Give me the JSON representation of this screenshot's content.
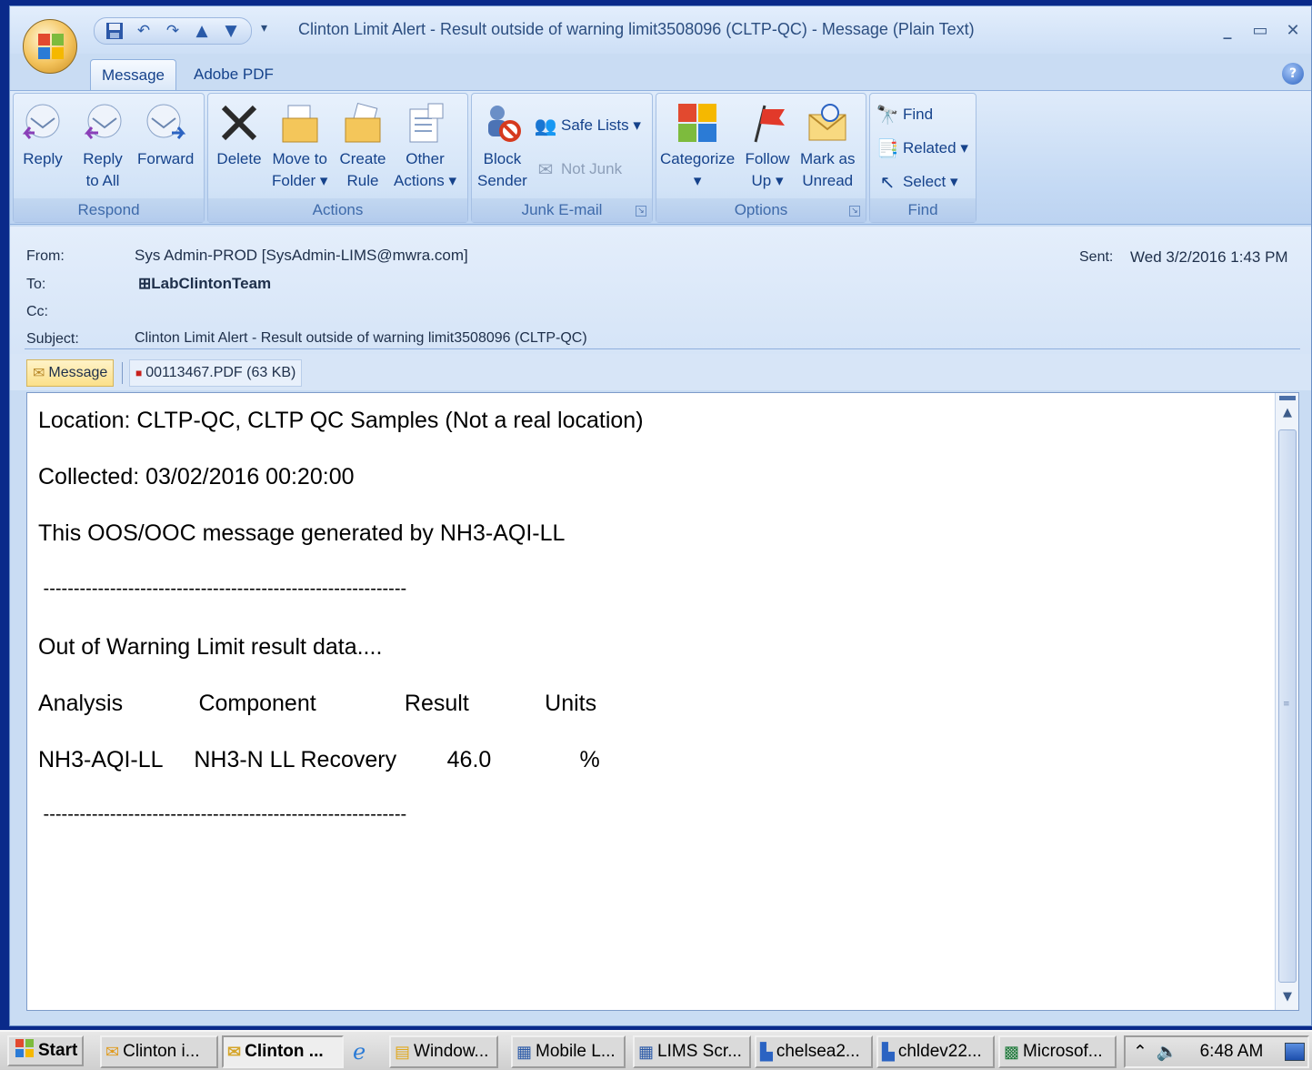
{
  "window": {
    "title": "Clinton Limit Alert - Result outside of warning limit3508096 (CLTP-QC)  - Message (Plain Text)",
    "quick_access": [
      "save-icon",
      "undo-icon",
      "redo-icon",
      "up-arrow-icon",
      "down-arrow-icon"
    ],
    "controls": [
      "minimize",
      "maximize",
      "close"
    ]
  },
  "tabs": [
    {
      "label": "Message",
      "active": true
    },
    {
      "label": "Adobe PDF",
      "active": false
    }
  ],
  "ribbon": {
    "respond": {
      "label": "Respond",
      "reply": "Reply",
      "reply_all": "Reply\nto All",
      "forward": "Forward"
    },
    "actions": {
      "label": "Actions",
      "delete": "Delete",
      "move_to_folder": "Move to\nFolder ▾",
      "create_rule": "Create\nRule",
      "other_actions": "Other\nActions ▾"
    },
    "junk": {
      "label": "Junk E-mail",
      "block_sender": "Block\nSender",
      "safe_lists": "Safe Lists ▾",
      "not_junk": "Not Junk"
    },
    "options": {
      "label": "Options",
      "categorize": "Categorize\n▾",
      "follow_up": "Follow\nUp ▾",
      "mark_as_unread": "Mark as\nUnread"
    },
    "find": {
      "label": "Find",
      "find": "Find",
      "related": "Related ▾",
      "select": "Select ▾"
    }
  },
  "header": {
    "from_label": "From:",
    "from_value": "Sys Admin-PROD [SysAdmin-LIMS@mwra.com]",
    "to_label": "To:",
    "to_value": "⊞LabClintonTeam",
    "cc_label": "Cc:",
    "subject_label": "Subject:",
    "subject_value": "Clinton Limit Alert - Result outside of warning limit3508096 (CLTP-QC)",
    "sent_label": "Sent:",
    "sent_value": "Wed 3/2/2016 1:43 PM"
  },
  "attachments": [
    {
      "label": "Message"
    },
    {
      "label": "00113467.PDF (63 KB)"
    }
  ],
  "body": {
    "lines": [
      "Location: CLTP-QC, CLTP QC Samples (Not a real location)",
      "Collected: 03/02/2016 00:20:00",
      "This OOS/OOC message generated by NH3-AQI-LL",
      " ------------------------------------------------------------",
      "Out of Warning Limit result data....",
      "Analysis            Component              Result            Units",
      "NH3-AQI-LL     NH3-N LL Recovery        46.0              %",
      " ------------------------------------------------------------"
    ]
  },
  "taskbar": {
    "start": "Start",
    "items": [
      {
        "label": "Clinton i...",
        "icon": "outlook-icon",
        "active": false
      },
      {
        "label": "Clinton ...",
        "icon": "mail-icon",
        "active": true
      },
      {
        "label": "",
        "icon": "ie-icon",
        "active": false
      },
      {
        "label": "Window...",
        "icon": "folder-icon",
        "active": false
      },
      {
        "label": "Mobile L...",
        "icon": "doc-icon",
        "active": false
      },
      {
        "label": "LIMS Scr...",
        "icon": "doc-icon",
        "active": false
      },
      {
        "label": "chelsea2...",
        "icon": "remote-icon",
        "active": false
      },
      {
        "label": "chldev22...",
        "icon": "remote-icon",
        "active": false
      },
      {
        "label": "Microsof...",
        "icon": "excel-icon",
        "active": false
      }
    ],
    "clock": "6:48 AM"
  }
}
